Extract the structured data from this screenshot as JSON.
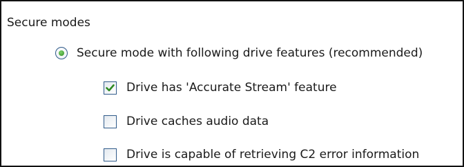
{
  "group": {
    "title": "Secure modes"
  },
  "options": {
    "secure_mode": {
      "label": "Secure mode with following drive features (recommended)",
      "selected": true
    },
    "accurate_stream": {
      "label": "Drive has 'Accurate Stream' feature",
      "checked": true
    },
    "caches_audio": {
      "label": "Drive caches audio data",
      "checked": false
    },
    "c2_error": {
      "label": "Drive is capable of retrieving C2 error information",
      "checked": false
    }
  },
  "colors": {
    "control_border": "#2f5a89",
    "check_mark": "#2e8a22"
  },
  "icons": {
    "radio_selected": "radio-selected-icon",
    "checkbox_checked": "check-mark-icon"
  }
}
